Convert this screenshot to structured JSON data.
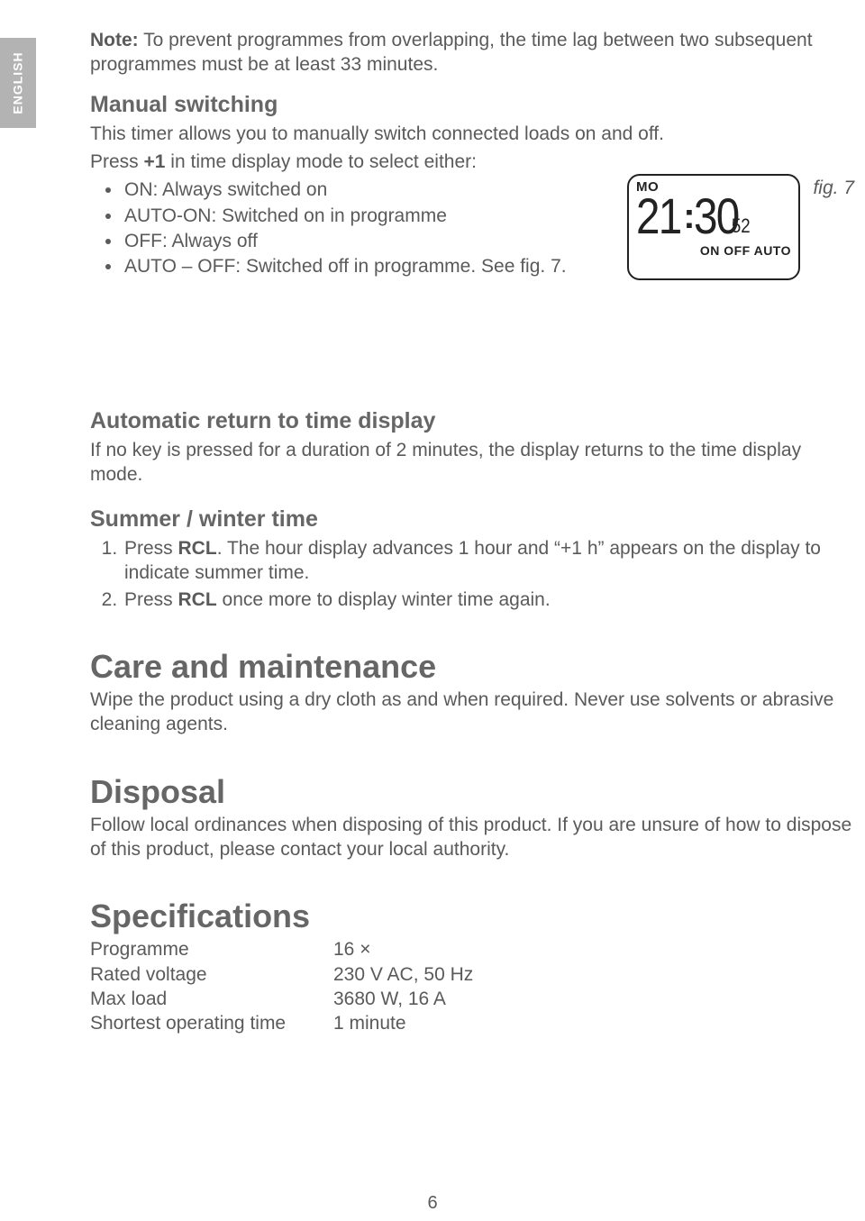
{
  "lang_tab": "ENGLISH",
  "note": {
    "label": "Note:",
    "text": " To prevent programmes from overlapping, the time lag between two subsequent programmes must be at least 33 minutes."
  },
  "manual_switching": {
    "heading": "Manual switching",
    "intro": "This timer allows you to manually switch connected loads on and off.",
    "press_pre": "Press ",
    "press_key": "+1",
    "press_post": " in time display mode to select either:",
    "items": [
      "ON: Always switched on",
      "AUTO-ON: Switched on in programme",
      "OFF: Always off",
      "AUTO – OFF: Switched off in programme. See fig. 7."
    ]
  },
  "fig7": {
    "label": "fig. 7",
    "day": "MO",
    "hh": "21",
    "colon": ":",
    "mm": "30",
    "ss": "52",
    "modes": "ON  OFF  AUTO"
  },
  "auto_return": {
    "heading": "Automatic return to time display",
    "text": "If no key is pressed for a duration of 2 minutes, the display returns to the time display mode."
  },
  "summer_winter": {
    "heading": "Summer / winter time",
    "item1_pre": "Press ",
    "item1_key": "RCL",
    "item1_post": ". The hour display advances 1 hour and “+1 h” appears on the display to indicate summer time.",
    "item2_pre": "Press ",
    "item2_key": "RCL",
    "item2_post": " once more to display winter time again."
  },
  "care": {
    "heading": "Care and maintenance",
    "text": "Wipe the product using a dry cloth as and when required. Never use solvents or abrasive cleaning agents."
  },
  "disposal": {
    "heading": "Disposal",
    "text": "Follow local ordinances when disposing of this product. If you are unsure of how to dispose of this product, please contact your local authority."
  },
  "specs": {
    "heading": "Specifications",
    "rows": [
      {
        "k": "Programme",
        "v": "16 ×"
      },
      {
        "k": "Rated voltage",
        "v": "230 V AC, 50 Hz"
      },
      {
        "k": "Max load",
        "v": "3680 W, 16 A"
      },
      {
        "k": "Shortest operating time",
        "v": "1 minute"
      }
    ]
  },
  "page_number": "6"
}
